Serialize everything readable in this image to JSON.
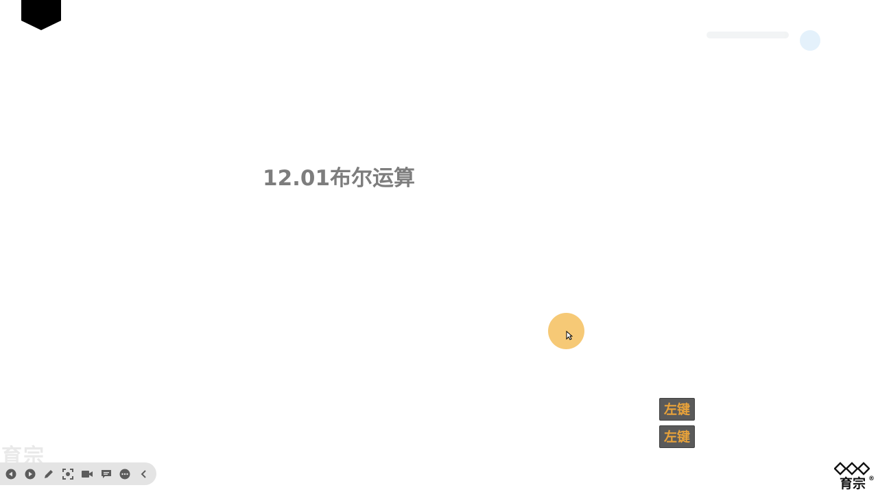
{
  "slide": {
    "title": "12.01布尔运算"
  },
  "keystrokes": [
    "左键",
    "左键"
  ],
  "watermarks": {
    "bottom_left": "育宗"
  },
  "toolbar": {
    "buttons": [
      {
        "icon": "previous-icon"
      },
      {
        "icon": "next-icon"
      },
      {
        "icon": "pen-icon"
      },
      {
        "icon": "screenshot-icon"
      },
      {
        "icon": "camera-icon"
      },
      {
        "icon": "comment-icon"
      },
      {
        "icon": "more-icon"
      },
      {
        "icon": "collapse-icon"
      }
    ]
  },
  "logo": {
    "text": "育宗",
    "mark": "®"
  },
  "colors": {
    "title": "#7d7d7d",
    "cursor_halo": "#f5c46a",
    "key_badge_bg": "#5a5a5a",
    "key_badge_text": "#e8a23a",
    "toolbar_bg": "#e4e4e4",
    "toolbar_icon": "#5c5c5c"
  }
}
